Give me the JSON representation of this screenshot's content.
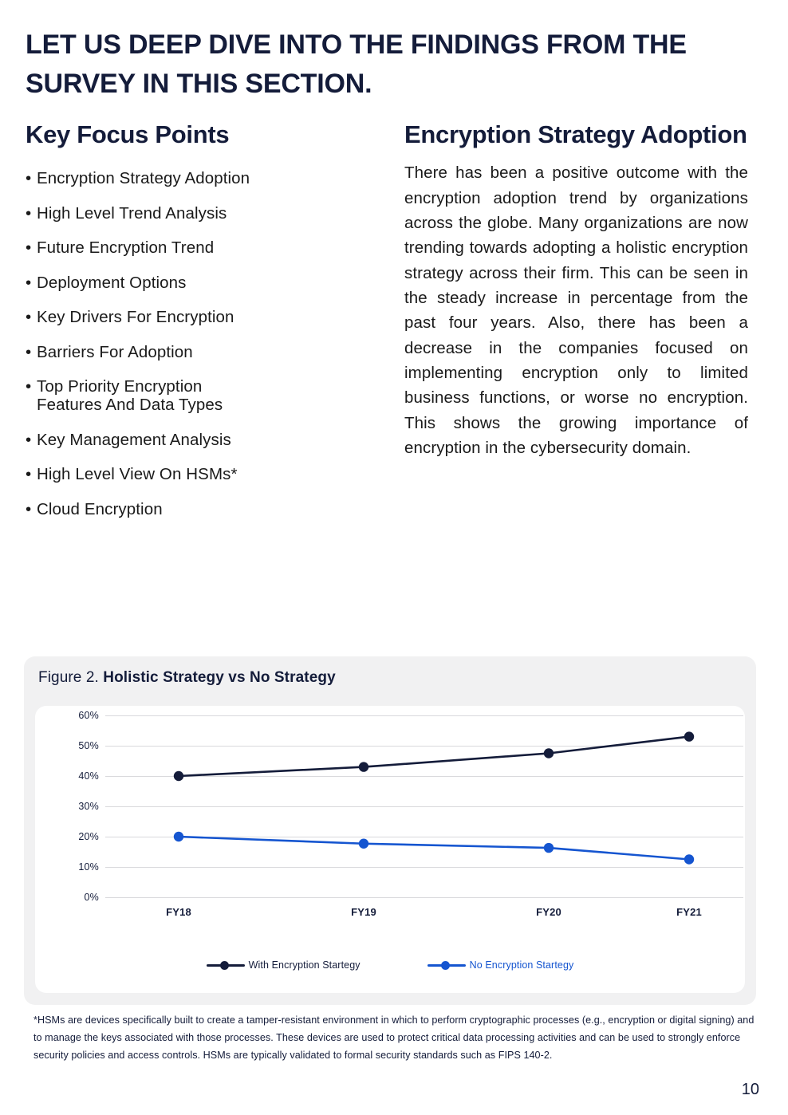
{
  "page": {
    "heading": "LET US DEEP DIVE INTO THE FINDINGS FROM THE SURVEY IN THIS SECTION.",
    "number": "10"
  },
  "left_column": {
    "title": "Key Focus Points",
    "bullet_glyph": "•",
    "items": [
      {
        "label": "Encryption Strategy Adoption"
      },
      {
        "label": "High Level Trend Analysis"
      },
      {
        "label": "Future Encryption Trend"
      },
      {
        "label": "Deployment Options"
      },
      {
        "label": "Key Drivers For Encryption"
      },
      {
        "label": "Barriers For Adoption"
      },
      {
        "label": "Top Priority Encryption\nFeatures And Data Types"
      },
      {
        "label": "Key Management Analysis"
      },
      {
        "label": "High Level View On HSMs*"
      },
      {
        "label": "Cloud Encryption"
      }
    ]
  },
  "right_column": {
    "title": "Encryption Strategy Adoption",
    "paragraph": "There has been a positive outcome with the encryption adoption trend by organizations across the globe. Many organizations are now trending towards adopting a holistic encryption strategy across their firm. This can be seen in the steady increase in percentage from the past four years. Also, there has been a decrease in the companies focused on implementing encryption only to limited business functions, or worse no encryption. This shows the growing importance of encryption in the cybersecurity domain."
  },
  "figure": {
    "caption_label": "Figure 2.",
    "caption_title": "Holistic Strategy vs No Strategy"
  },
  "chart_data": {
    "type": "line",
    "title": "Holistic Strategy vs No Strategy",
    "xlabel": "",
    "ylabel": "",
    "categories": [
      "FY18",
      "FY19",
      "FY20",
      "FY21"
    ],
    "ylim": [
      0,
      60
    ],
    "ytick_labels": [
      "0%",
      "10%",
      "20%",
      "30%",
      "40%",
      "50%",
      "60%"
    ],
    "ytick_values": [
      0,
      10,
      20,
      30,
      40,
      50,
      60
    ],
    "grid": true,
    "legend_position": "bottom",
    "series": [
      {
        "name": "With Encryption Startegy",
        "color": "#141c3a",
        "values": [
          40,
          43,
          47.5,
          53
        ]
      },
      {
        "name": "No Encryption Startegy",
        "color": "#1555d0",
        "values": [
          20,
          17.7,
          16.3,
          12.5
        ]
      }
    ]
  },
  "footnote": {
    "text": "*HSMs are devices specifically built to create a tamper-resistant environment in which to perform cryptographic processes (e.g., encryption or digital signing) and to manage the keys associated with those processes. These devices are used to protect critical data processing activities and can be used to strongly enforce security policies and access controls. HSMs are typically validated to formal security standards such as FIPS 140-2."
  },
  "colors": {
    "brand_navy": "#141c3a",
    "accent_blue": "#1555d0",
    "card_background": "#f1f1f2",
    "gridline": "#d9d9dc"
  }
}
